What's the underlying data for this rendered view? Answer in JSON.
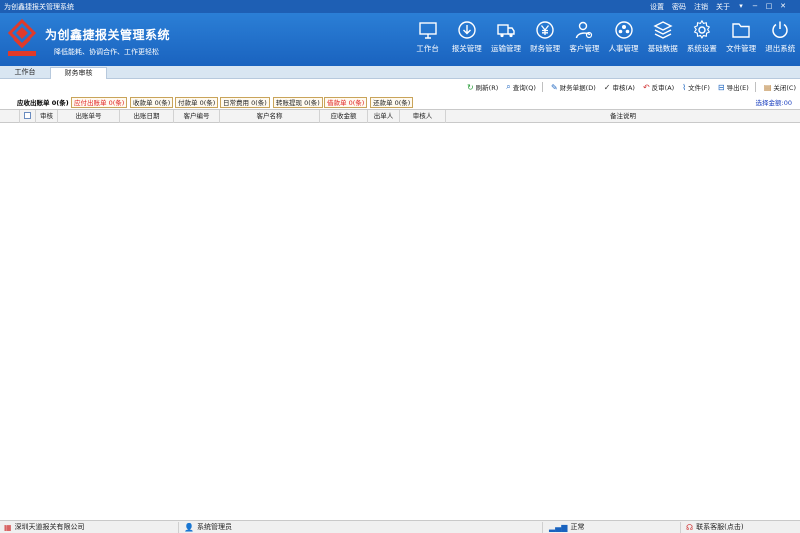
{
  "window": {
    "title": "为创鑫捷报关管理系统"
  },
  "title_links": {
    "settings": "设置",
    "password": "密码",
    "logout": "注销",
    "about": "关于"
  },
  "header": {
    "app_title": "为创鑫捷报关管理系统",
    "slogan": "降低能耗、协调合作、工作更轻松",
    "modules": [
      {
        "label": "工作台",
        "icon": "monitor-icon"
      },
      {
        "label": "报关管理",
        "icon": "download-circle-icon"
      },
      {
        "label": "运输管理",
        "icon": "truck-icon"
      },
      {
        "label": "财务管理",
        "icon": "yen-icon"
      },
      {
        "label": "客户管理",
        "icon": "user-gear-icon"
      },
      {
        "label": "人事管理",
        "icon": "people-icon"
      },
      {
        "label": "基础数据",
        "icon": "layers-icon"
      },
      {
        "label": "系统设置",
        "icon": "gear-icon"
      },
      {
        "label": "文件管理",
        "icon": "folder-icon"
      },
      {
        "label": "退出系统",
        "icon": "power-icon"
      }
    ]
  },
  "page_tabs": [
    "工作台",
    "财务审核"
  ],
  "toolbar": {
    "refresh": "刷新(R)",
    "query": "查询(Q)",
    "voucher": "财务单据(D)",
    "approve": "审核(A)",
    "unapprove": "反审(A)",
    "file": "文件(F)",
    "export": "导出(E)",
    "close": "关闭(C)"
  },
  "doc_tabs": [
    "应收出账单 0(条)",
    "应付出账单 0(条)",
    "收款单 0(条)",
    "付款单 0(条)",
    "日常费用 0(条)",
    "转账提现 0(条)",
    "借款单 0(条)",
    "还款单 0(条)"
  ],
  "select_sum": "选择金额:00",
  "grid": {
    "columns": [
      "审核",
      "出账单号",
      "出账日期",
      "客户编号",
      "客户名称",
      "应收金额",
      "出单人",
      "审核人",
      "备注说明"
    ]
  },
  "status": {
    "company": "深圳天道报关有限公司",
    "user": "系统管理员",
    "state": "正常",
    "support": "联系客服(点击)"
  },
  "colors": {
    "header_blue": "#1e5fb4",
    "accent_red": "#e02020",
    "link_blue": "#1a3fbf"
  }
}
